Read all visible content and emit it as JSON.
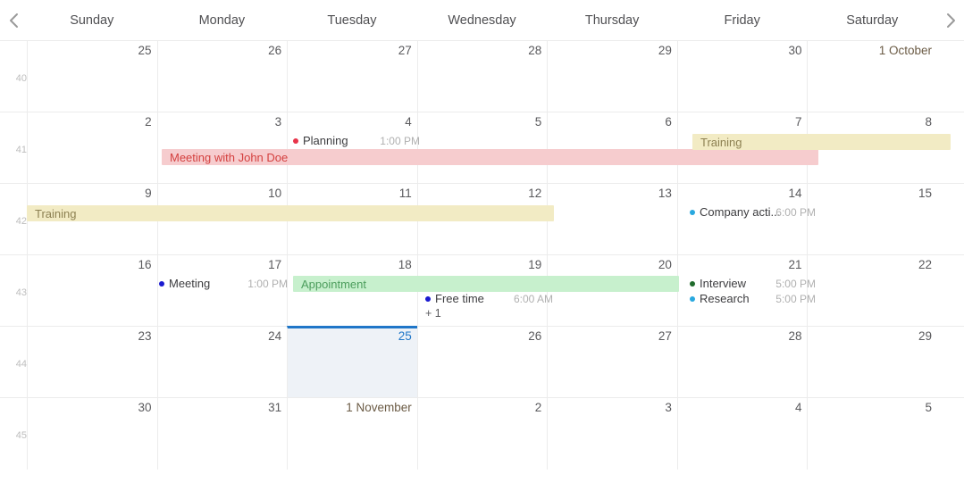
{
  "nav": {
    "prev_icon": "chevron-left-icon",
    "next_icon": "chevron-right-icon",
    "prev_label": "‹",
    "next_label": "›"
  },
  "weekdays": [
    "Sunday",
    "Monday",
    "Tuesday",
    "Wednesday",
    "Thursday",
    "Friday",
    "Saturday"
  ],
  "weeks": [
    {
      "number": "40",
      "days": [
        {
          "label": "25",
          "selected": false,
          "month_start": false
        },
        {
          "label": "26",
          "selected": false,
          "month_start": false
        },
        {
          "label": "27",
          "selected": false,
          "month_start": false
        },
        {
          "label": "28",
          "selected": false,
          "month_start": false
        },
        {
          "label": "29",
          "selected": false,
          "month_start": false
        },
        {
          "label": "30",
          "selected": false,
          "month_start": false
        },
        {
          "label": "1 October",
          "selected": false,
          "month_start": true
        }
      ]
    },
    {
      "number": "41",
      "days": [
        {
          "label": "2",
          "selected": false,
          "month_start": false
        },
        {
          "label": "3",
          "selected": false,
          "month_start": false
        },
        {
          "label": "4",
          "selected": false,
          "month_start": false
        },
        {
          "label": "5",
          "selected": false,
          "month_start": false
        },
        {
          "label": "6",
          "selected": false,
          "month_start": false
        },
        {
          "label": "7",
          "selected": false,
          "month_start": false
        },
        {
          "label": "8",
          "selected": false,
          "month_start": false
        }
      ]
    },
    {
      "number": "42",
      "days": [
        {
          "label": "9",
          "selected": false,
          "month_start": false
        },
        {
          "label": "10",
          "selected": false,
          "month_start": false
        },
        {
          "label": "11",
          "selected": false,
          "month_start": false
        },
        {
          "label": "12",
          "selected": false,
          "month_start": false
        },
        {
          "label": "13",
          "selected": false,
          "month_start": false
        },
        {
          "label": "14",
          "selected": false,
          "month_start": false
        },
        {
          "label": "15",
          "selected": false,
          "month_start": false
        }
      ]
    },
    {
      "number": "43",
      "days": [
        {
          "label": "16",
          "selected": false,
          "month_start": false
        },
        {
          "label": "17",
          "selected": false,
          "month_start": false
        },
        {
          "label": "18",
          "selected": false,
          "month_start": false
        },
        {
          "label": "19",
          "selected": false,
          "month_start": false
        },
        {
          "label": "20",
          "selected": false,
          "month_start": false
        },
        {
          "label": "21",
          "selected": false,
          "month_start": false
        },
        {
          "label": "22",
          "selected": false,
          "month_start": false
        }
      ]
    },
    {
      "number": "44",
      "days": [
        {
          "label": "23",
          "selected": false,
          "month_start": false
        },
        {
          "label": "24",
          "selected": false,
          "month_start": false
        },
        {
          "label": "25",
          "selected": true,
          "month_start": false
        },
        {
          "label": "26",
          "selected": false,
          "month_start": false
        },
        {
          "label": "27",
          "selected": false,
          "month_start": false
        },
        {
          "label": "28",
          "selected": false,
          "month_start": false
        },
        {
          "label": "29",
          "selected": false,
          "month_start": false
        }
      ]
    },
    {
      "number": "45",
      "days": [
        {
          "label": "30",
          "selected": false,
          "month_start": false
        },
        {
          "label": "31",
          "selected": false,
          "month_start": false
        },
        {
          "label": "1 November",
          "selected": false,
          "month_start": true
        },
        {
          "label": "2",
          "selected": false,
          "month_start": false
        },
        {
          "label": "3",
          "selected": false,
          "month_start": false
        },
        {
          "label": "4",
          "selected": false,
          "month_start": false
        },
        {
          "label": "5",
          "selected": false,
          "month_start": false
        }
      ]
    }
  ],
  "events": {
    "week41": {
      "planning": {
        "title": "Planning",
        "time": "1:00 PM",
        "dot_color": "#e8344a"
      },
      "meeting_john_doe": {
        "title": "Meeting with John Doe",
        "bg": "#f6ccce",
        "fg": "#d4403f"
      },
      "training": {
        "title": "Training",
        "bg": "#f2ebc4",
        "fg": "#8d8152"
      }
    },
    "week42": {
      "training": {
        "title": "Training",
        "bg": "#f2ebc4",
        "fg": "#8d8152"
      },
      "company_activity": {
        "title": "Company acti...",
        "time": "6:00 PM",
        "dot_color": "#29a8df"
      }
    },
    "week43": {
      "meeting": {
        "title": "Meeting",
        "time": "1:00 PM",
        "dot_color": "#1a1ad0"
      },
      "appointment": {
        "title": "Appointment",
        "bg": "#c7f0cd",
        "fg": "#4d9e5d"
      },
      "free_time": {
        "title": "Free time",
        "time": "6:00 AM",
        "dot_color": "#1a1ad0"
      },
      "more": "+ 1",
      "interview": {
        "title": "Interview",
        "time": "5:00 PM",
        "dot_color": "#1f6b2c"
      },
      "research": {
        "title": "Research",
        "time": "5:00 PM",
        "dot_color": "#29a8df"
      }
    }
  },
  "colors": {
    "grid_line": "#ececec",
    "selected_bg": "#eef2f7",
    "selected_border": "#1f76c8",
    "day_number": "#5a5a5d",
    "week_number": "#bdbdbd",
    "event_time": "#b0b0b0"
  }
}
